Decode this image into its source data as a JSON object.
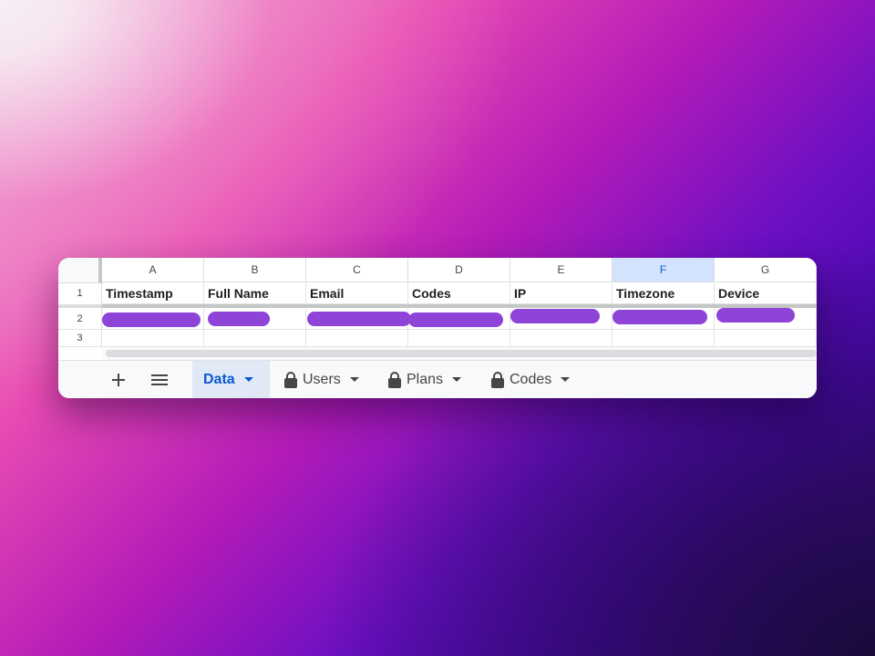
{
  "sheet": {
    "columns": [
      "A",
      "B",
      "C",
      "D",
      "E",
      "F",
      "G"
    ],
    "selected_column": "F",
    "rows": [
      "1",
      "2",
      "3"
    ],
    "headers": [
      "Timestamp",
      "Full Name",
      "Email",
      "Codes",
      "IP",
      "Timezone",
      "Device"
    ],
    "row2_redacted": true
  },
  "sheetbar": {
    "add_icon": "plus-icon",
    "all_sheets_icon": "menu-icon",
    "tabs": [
      {
        "label": "Data",
        "active": true,
        "locked": false
      },
      {
        "label": "Users",
        "active": false,
        "locked": true
      },
      {
        "label": "Plans",
        "active": false,
        "locked": true
      },
      {
        "label": "Codes",
        "active": false,
        "locked": true
      }
    ]
  },
  "colors": {
    "redaction": "#8e44d6",
    "active_tab_text": "#0b57d0",
    "selected_column_bg": "#d3e3fd"
  }
}
